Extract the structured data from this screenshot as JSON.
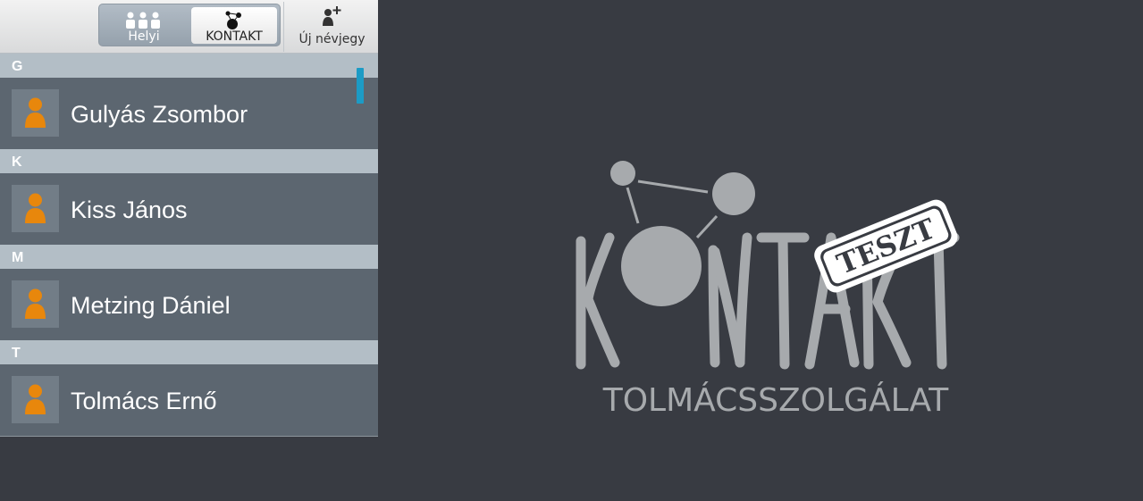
{
  "toolbar": {
    "local_label": "Helyi",
    "kontakt_label": "KONTAKT",
    "new_card_label": "Új névjegy"
  },
  "contacts": {
    "sections": [
      {
        "letter": "G",
        "name": "Gulyás Zsombor"
      },
      {
        "letter": "K",
        "name": "Kiss János"
      },
      {
        "letter": "M",
        "name": "Metzing Dániel"
      },
      {
        "letter": "T",
        "name": "Tolmács Ernő"
      }
    ]
  },
  "logo": {
    "wordmark": "KONTAKT",
    "stamp": "TESZT",
    "tagline": "TOLMÁCSSZOLGÁLAT"
  },
  "colors": {
    "background": "#383b42",
    "row": "#5c6670",
    "section_header": "#b3bec6",
    "avatar_person": "#e8870c",
    "scrollbar": "#1c9bc5",
    "logo": "#a7aaad"
  },
  "icons": [
    "people-icon",
    "kontakt-icon",
    "add-person-icon",
    "person-icon"
  ]
}
